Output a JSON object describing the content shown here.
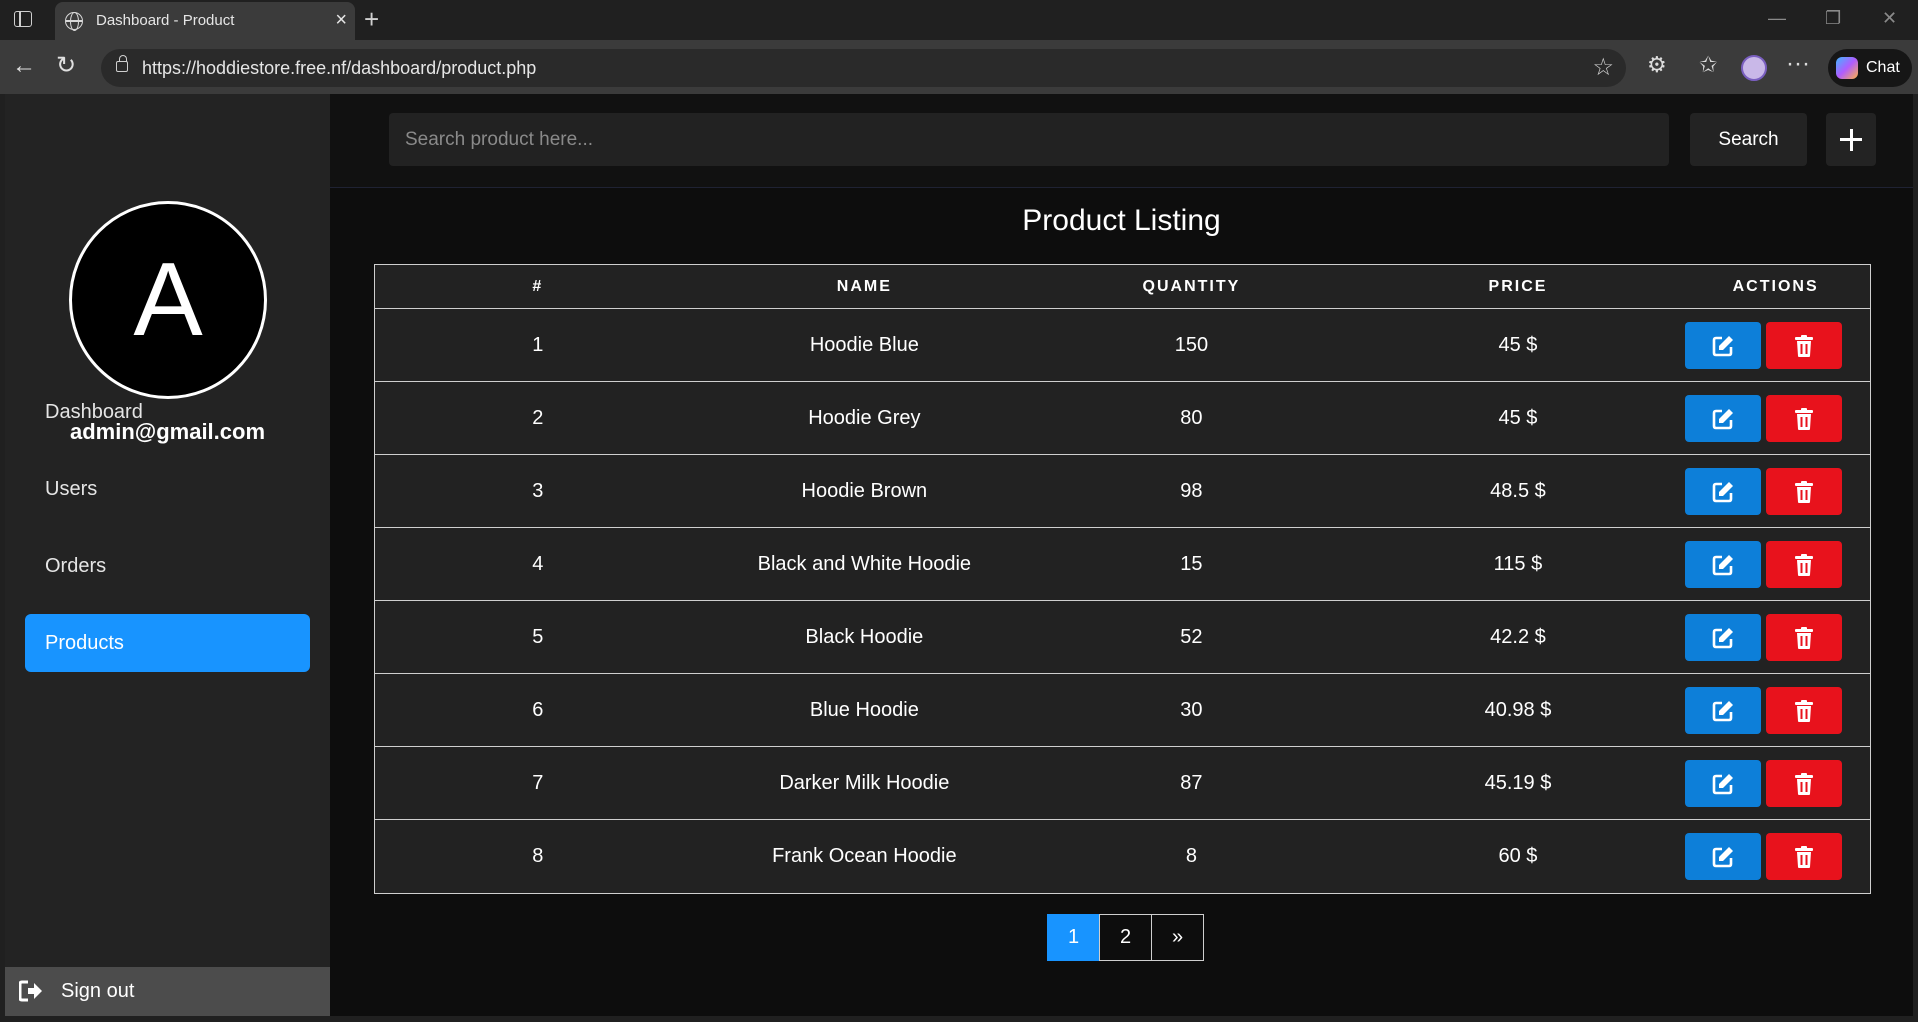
{
  "browser": {
    "tab_title": "Dashboard - Product",
    "url": "https://hoddiestore.free.nf/dashboard/product.php",
    "chat_label": "Chat"
  },
  "sidebar": {
    "avatar_letter": "A",
    "email": "admin@gmail.com",
    "items": [
      {
        "label": "Dashboard",
        "active": false
      },
      {
        "label": "Users",
        "active": false
      },
      {
        "label": "Orders",
        "active": false
      },
      {
        "label": "Products",
        "active": true
      }
    ],
    "signout_label": "Sign out"
  },
  "search": {
    "placeholder": "Search product here...",
    "button_label": "Search"
  },
  "page": {
    "title": "Product Listing"
  },
  "table": {
    "headers": [
      "#",
      "NAME",
      "QUANTITY",
      "PRICE",
      "ACTIONS"
    ],
    "rows": [
      {
        "id": "1",
        "name": "Hoodie Blue",
        "quantity": "150",
        "price": "45 $"
      },
      {
        "id": "2",
        "name": "Hoodie Grey",
        "quantity": "80",
        "price": "45 $"
      },
      {
        "id": "3",
        "name": "Hoodie Brown",
        "quantity": "98",
        "price": "48.5 $"
      },
      {
        "id": "4",
        "name": "Black and White Hoodie",
        "quantity": "15",
        "price": "115 $"
      },
      {
        "id": "5",
        "name": "Black Hoodie",
        "quantity": "52",
        "price": "42.2 $"
      },
      {
        "id": "6",
        "name": "Blue Hoodie",
        "quantity": "30",
        "price": "40.98 $"
      },
      {
        "id": "7",
        "name": "Darker Milk Hoodie",
        "quantity": "87",
        "price": "45.19 $"
      },
      {
        "id": "8",
        "name": "Frank Ocean Hoodie",
        "quantity": "8",
        "price": "60 $"
      }
    ]
  },
  "pagination": {
    "pages": [
      "1",
      "2",
      "»"
    ],
    "active_index": 0
  },
  "colors": {
    "accent": "#1894ff",
    "edit": "#0d7fd9",
    "delete": "#e8121c",
    "sidebar_bg": "#232323",
    "main_bg": "#0d0d0d"
  },
  "icons": {
    "edit": "edit-icon",
    "delete": "trash-icon",
    "signout": "sign-out-icon",
    "add": "plus-icon"
  }
}
